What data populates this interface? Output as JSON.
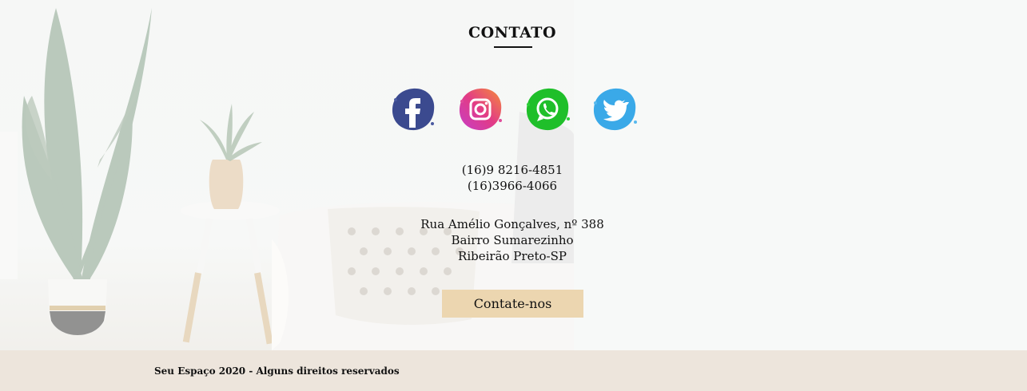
{
  "section": {
    "title": "CONTATO"
  },
  "social": [
    {
      "name": "facebook-icon",
      "color": "#3b4a8f"
    },
    {
      "name": "instagram-icon",
      "color": "#d83f8a"
    },
    {
      "name": "whatsapp-icon",
      "color": "#1fbf2a"
    },
    {
      "name": "twitter-icon",
      "color": "#3aa9e8"
    }
  ],
  "phones": [
    "(16)9 8216-4851",
    "(16)3966-4066"
  ],
  "address": [
    "Rua Amélio Gonçalves, nº 388",
    "Bairro Sumarezinho",
    "Ribeirão Preto-SP"
  ],
  "cta": {
    "label": "Contate-nos",
    "color": "#ecd6b0"
  },
  "footer": {
    "text": "Seu Espaço 2020 - Alguns direitos reservados",
    "color": "#ede5dc"
  }
}
